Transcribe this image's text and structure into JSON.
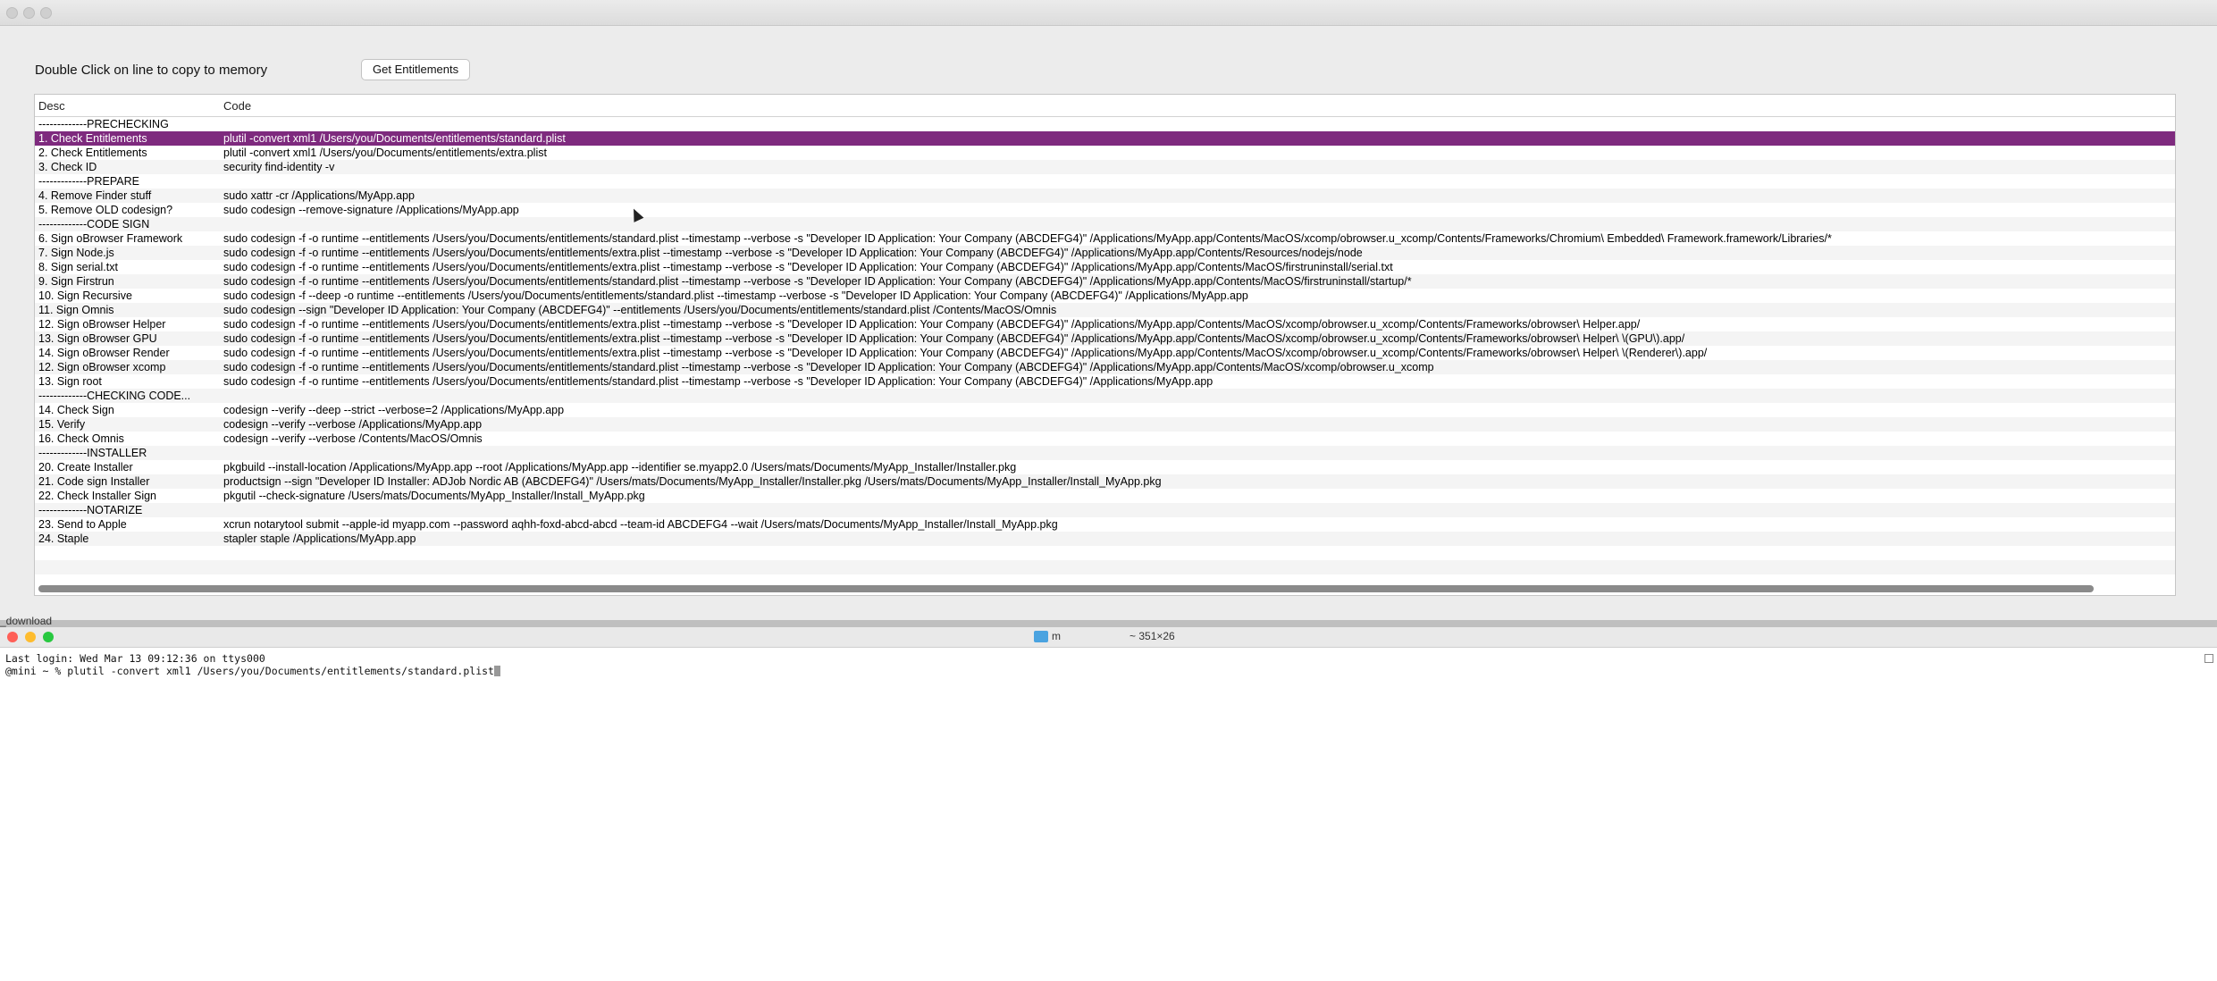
{
  "app": {
    "instruction": "Double Click on line to copy to memory",
    "get_button": "Get Entitlements",
    "columns": {
      "desc": "Desc",
      "code": "Code"
    },
    "rows": [
      {
        "desc": "-------------PRECHECKING",
        "code": ""
      },
      {
        "desc": "1. Check Entitlements",
        "code": "plutil -convert xml1 /Users/you/Documents/entitlements/standard.plist",
        "selected": true
      },
      {
        "desc": "2. Check Entitlements",
        "code": "plutil -convert xml1 /Users/you/Documents/entitlements/extra.plist"
      },
      {
        "desc": "3. Check ID",
        "code": "security find-identity -v"
      },
      {
        "desc": "-------------PREPARE",
        "code": ""
      },
      {
        "desc": "4. Remove Finder stuff",
        "code": "sudo xattr -cr /Applications/MyApp.app"
      },
      {
        "desc": "5. Remove OLD codesign?",
        "code": "sudo codesign  --remove-signature /Applications/MyApp.app"
      },
      {
        "desc": "-------------CODE SIGN",
        "code": ""
      },
      {
        "desc": "6. Sign oBrowser Framework",
        "code": "sudo codesign -f -o runtime --entitlements /Users/you/Documents/entitlements/standard.plist --timestamp --verbose -s \"Developer ID Application: Your Company (ABCDEFG4)\" /Applications/MyApp.app/Contents/MacOS/xcomp/obrowser.u_xcomp/Contents/Frameworks/Chromium\\ Embedded\\ Framework.framework/Libraries/*"
      },
      {
        "desc": "7. Sign Node.js",
        "code": "sudo codesign -f -o runtime --entitlements /Users/you/Documents/entitlements/extra.plist --timestamp --verbose -s \"Developer ID Application: Your Company (ABCDEFG4)\" /Applications/MyApp.app/Contents/Resources/nodejs/node"
      },
      {
        "desc": "8. Sign serial.txt",
        "code": "sudo codesign -f -o runtime --entitlements /Users/you/Documents/entitlements/extra.plist --timestamp --verbose -s \"Developer ID Application: Your Company (ABCDEFG4)\" /Applications/MyApp.app/Contents/MacOS/firstruninstall/serial.txt"
      },
      {
        "desc": "9. Sign Firstrun",
        "code": "sudo codesign -f -o runtime --entitlements /Users/you/Documents/entitlements/standard.plist --timestamp --verbose -s \"Developer ID Application: Your Company (ABCDEFG4)\" /Applications/MyApp.app/Contents/MacOS/firstruninstall/startup/*"
      },
      {
        "desc": "10. Sign Recursive",
        "code": "sudo codesign -f --deep -o runtime --entitlements /Users/you/Documents/entitlements/standard.plist --timestamp --verbose -s \"Developer ID Application: Your Company (ABCDEFG4)\" /Applications/MyApp.app"
      },
      {
        "desc": "11. Sign Omnis",
        "code": "sudo codesign --sign \"Developer ID Application: Your Company (ABCDEFG4)\" --entitlements /Users/you/Documents/entitlements/standard.plist /Contents/MacOS/Omnis"
      },
      {
        "desc": "12. Sign oBrowser Helper",
        "code": "sudo codesign -f -o runtime --entitlements /Users/you/Documents/entitlements/extra.plist --timestamp --verbose -s \"Developer ID Application: Your Company (ABCDEFG4)\" /Applications/MyApp.app/Contents/MacOS/xcomp/obrowser.u_xcomp/Contents/Frameworks/obrowser\\ Helper.app/"
      },
      {
        "desc": "13. Sign oBrowser GPU",
        "code": "sudo codesign -f -o runtime --entitlements /Users/you/Documents/entitlements/extra.plist --timestamp --verbose -s \"Developer ID Application: Your Company (ABCDEFG4)\" /Applications/MyApp.app/Contents/MacOS/xcomp/obrowser.u_xcomp/Contents/Frameworks/obrowser\\ Helper\\ \\(GPU\\).app/"
      },
      {
        "desc": "14. Sign oBrowser Render",
        "code": "sudo codesign -f -o runtime --entitlements /Users/you/Documents/entitlements/extra.plist --timestamp --verbose -s \"Developer ID Application: Your Company (ABCDEFG4)\" /Applications/MyApp.app/Contents/MacOS/xcomp/obrowser.u_xcomp/Contents/Frameworks/obrowser\\ Helper\\ \\(Renderer\\).app/"
      },
      {
        "desc": "12. Sign oBrowser xcomp",
        "code": "sudo codesign -f -o runtime --entitlements /Users/you/Documents/entitlements/standard.plist --timestamp --verbose -s \"Developer ID Application: Your Company (ABCDEFG4)\" /Applications/MyApp.app/Contents/MacOS/xcomp/obrowser.u_xcomp"
      },
      {
        "desc": "13. Sign root",
        "code": "sudo codesign -f -o runtime --entitlements /Users/you/Documents/entitlements/standard.plist --timestamp --verbose -s \"Developer ID Application: Your Company (ABCDEFG4)\" /Applications/MyApp.app"
      },
      {
        "desc": "-------------CHECKING CODE...",
        "code": ""
      },
      {
        "desc": "14. Check Sign",
        "code": "codesign --verify --deep --strict --verbose=2  /Applications/MyApp.app"
      },
      {
        "desc": "15. Verify",
        "code": "codesign --verify --verbose /Applications/MyApp.app"
      },
      {
        "desc": "16. Check Omnis",
        "code": "codesign --verify --verbose /Contents/MacOS/Omnis"
      },
      {
        "desc": "-------------INSTALLER",
        "code": ""
      },
      {
        "desc": "20. Create Installer",
        "code": "pkgbuild --install-location /Applications/MyApp.app --root /Applications/MyApp.app --identifier se.myapp2.0 /Users/mats/Documents/MyApp_Installer/Installer.pkg"
      },
      {
        "desc": "21. Code sign Installer",
        "code": "productsign --sign \"Developer ID Installer: ADJob Nordic AB (ABCDEFG4)\" /Users/mats/Documents/MyApp_Installer/Installer.pkg /Users/mats/Documents/MyApp_Installer/Install_MyApp.pkg"
      },
      {
        "desc": "22. Check Installer Sign",
        "code": "pkgutil --check-signature /Users/mats/Documents/MyApp_Installer/Install_MyApp.pkg"
      },
      {
        "desc": "-------------NOTARIZE",
        "code": ""
      },
      {
        "desc": "23. Send to Apple",
        "code": "xcrun notarytool submit --apple-id myapp.com --password aqhh-foxd-abcd-abcd --team-id ABCDEFG4 --wait /Users/mats/Documents/MyApp_Installer/Install_MyApp.pkg"
      },
      {
        "desc": "24. Staple",
        "code": "stapler staple /Applications/MyApp.app"
      }
    ],
    "selection_color": "#7e2a7e"
  },
  "background_fragment": "_download",
  "terminal": {
    "folder": "m",
    "size": "~ 351×26",
    "last_login": "Last login: Wed Mar 13 09:12:36 on ttys000",
    "prompt": "@mini ~ % plutil -convert xml1 /Users/you/Documents/entitlements/standard.plist"
  }
}
